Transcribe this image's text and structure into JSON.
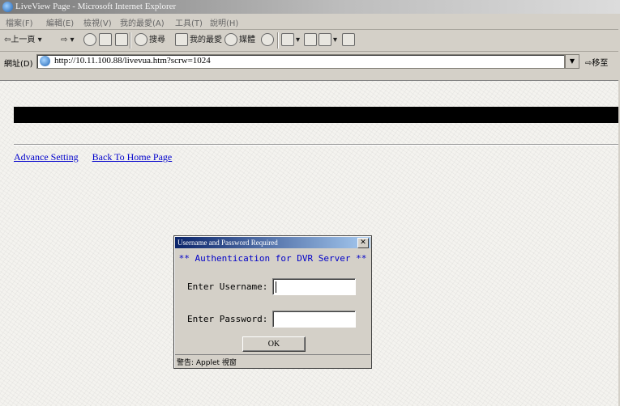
{
  "window": {
    "title": "LiveView Page - Microsoft Internet Explorer"
  },
  "menubar": {
    "items": [
      "檔案(F)",
      "編輯(E)",
      "檢視(V)",
      "我的最愛(A)",
      "工具(T)",
      "說明(H)"
    ]
  },
  "toolbar": {
    "back_label": "上一頁",
    "search_label": "搜尋",
    "favorites_label": "我的最愛",
    "media_label": "媒體"
  },
  "address": {
    "label": "網址(D)",
    "url": "http://10.11.100.88/livevua.htm?scrw=1024",
    "go_label": "移至"
  },
  "page": {
    "links": [
      "Advance Setting",
      "Back To Home Page"
    ]
  },
  "dialog": {
    "title": "Username and Password Required",
    "heading": "** Authentication for DVR Server **",
    "username_label": "Enter Username:",
    "password_label": "Enter Password:",
    "username_value": "",
    "password_value": "",
    "ok_label": "OK",
    "status": "警告: Applet 視窗"
  },
  "colors": {
    "link": "#0000cc",
    "dialog_heading": "#0000c8",
    "dialog_titlebar": "#0a246a"
  }
}
